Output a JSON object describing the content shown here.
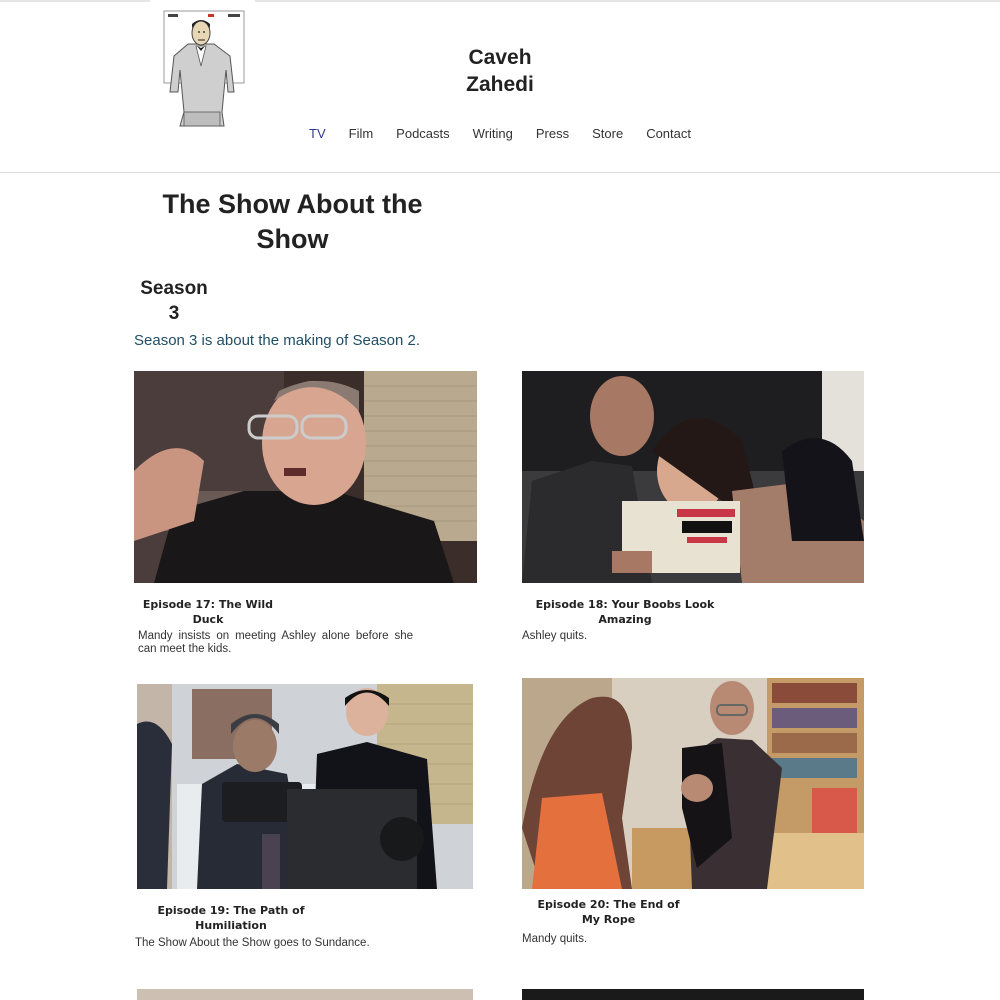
{
  "site": {
    "title": "Caveh Zahedi",
    "logo_icon": "caricature-logo"
  },
  "nav": {
    "items": [
      {
        "label": "TV",
        "active": true
      },
      {
        "label": "Film"
      },
      {
        "label": "Podcasts"
      },
      {
        "label": "Writing"
      },
      {
        "label": "Press"
      },
      {
        "label": "Store"
      },
      {
        "label": "Contact"
      }
    ],
    "active_color": "#2f3a8f"
  },
  "page": {
    "title": "The Show About the Show"
  },
  "season": {
    "title": "Season 3",
    "description": "Season 3 is about the making of Season 2."
  },
  "episodes": [
    {
      "title": "Episode 17: The Wild Duck",
      "description": "Mandy insists on meeting Ashley alone before she can meet the kids."
    },
    {
      "title": "Episode 18: Your Boobs Look Amazing",
      "description": "Ashley quits."
    },
    {
      "title": "Episode 19: The Path of Humiliation",
      "description": "The Show About the Show goes to Sundance."
    },
    {
      "title": "Episode 20: The End of My Rope",
      "description": "Mandy quits."
    }
  ]
}
